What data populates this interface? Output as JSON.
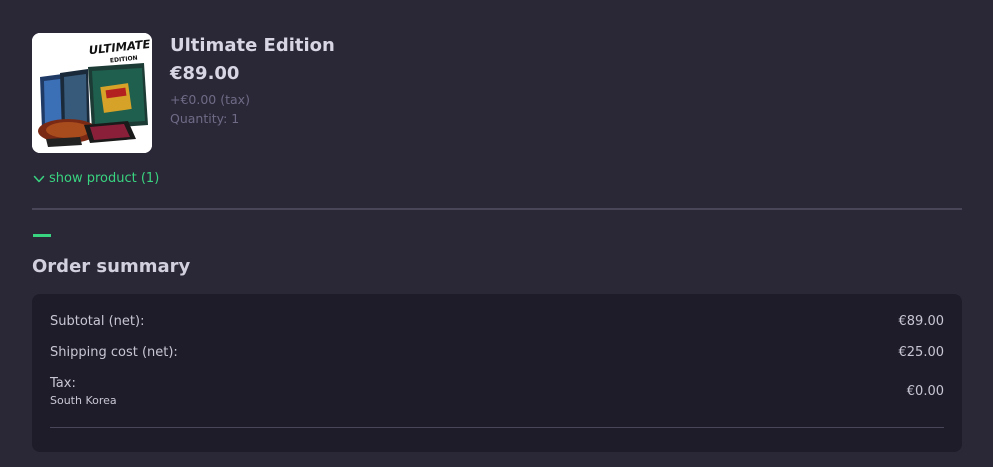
{
  "product": {
    "image_text_top": "ULTIMATE",
    "image_text_bottom": "EDITION",
    "name": "Ultimate Edition",
    "price": "€89.00",
    "tax": "+€0.00 (tax)",
    "quantity": "Quantity: 1",
    "show_product_label": "show product (1)"
  },
  "summary": {
    "title": "Order summary",
    "rows": [
      {
        "label": "Subtotal (net):",
        "value": "€89.00"
      },
      {
        "label": "Shipping cost (net):",
        "value": "€25.00"
      },
      {
        "label": "Tax:",
        "sublabel": "South Korea",
        "value": "€0.00"
      }
    ]
  },
  "colors": {
    "background": "#2a2737",
    "panel": "#1e1c28",
    "accent": "#39d47f"
  }
}
